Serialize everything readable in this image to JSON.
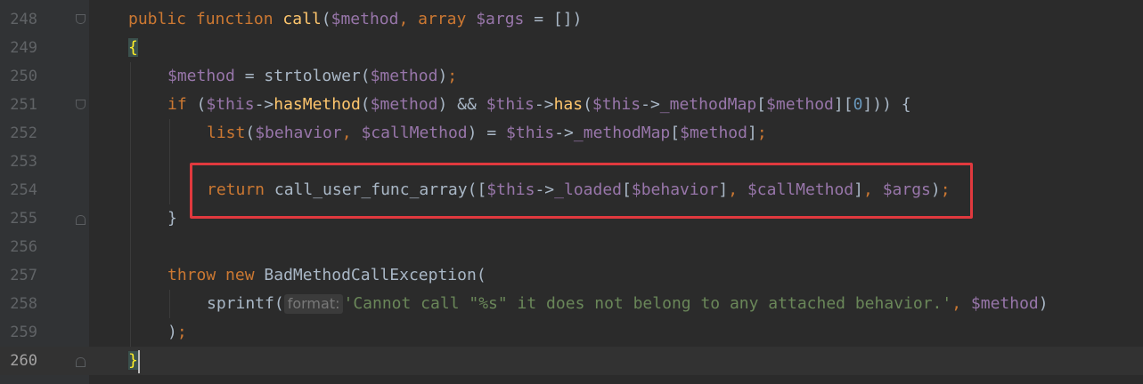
{
  "gutter": {
    "line_numbers": [
      "248",
      "249",
      "250",
      "251",
      "252",
      "253",
      "254",
      "255",
      "256",
      "257",
      "258",
      "259",
      "260"
    ]
  },
  "code": {
    "l248": {
      "kw1": "public",
      "kw2": "function",
      "fn": "call",
      "p1": "(",
      "v1": "$method",
      "c1": ", ",
      "kw3": "array",
      "sp": " ",
      "v2": "$args",
      "p2": " = [])"
    },
    "l249": {
      "brace": "{"
    },
    "l250": {
      "v1": "$method",
      "p1": " = strtolower(",
      "v2": "$method",
      "p2": ")",
      "sc": ";"
    },
    "l251": {
      "kw": "if",
      "p1": " (",
      "v1": "$this",
      "a1": "->",
      "fn1": "hasMethod",
      "p2": "(",
      "v2": "$method",
      "p3": ") && ",
      "v3": "$this",
      "a2": "->",
      "fn2": "has",
      "p4": "(",
      "v4": "$this",
      "a3": "->",
      "v5": "_methodMap",
      "p5": "[",
      "v6": "$method",
      "p6": "][",
      "n": "0",
      "p7": "])) {"
    },
    "l252": {
      "kw": "list",
      "p1": "(",
      "v1": "$behavior",
      "c1": ", ",
      "v2": "$callMethod",
      "p2": ") = ",
      "v3": "$this",
      "a1": "->",
      "v4": "_methodMap",
      "p3": "[",
      "v5": "$method",
      "p4": "]",
      "sc": ";"
    },
    "l254": {
      "kw": "return",
      "p1": " call_user_func_array([",
      "v1": "$this",
      "a1": "->",
      "v2": "_loaded",
      "p2": "[",
      "v3": "$behavior",
      "p3": "]",
      "c1": ", ",
      "v4": "$callMethod",
      "p4": "]",
      "c2": ", ",
      "v5": "$args",
      "p5": ")",
      "sc": ";"
    },
    "l255": {
      "brace": "}"
    },
    "l257": {
      "kw1": "throw",
      "kw2": "new",
      "cls": "BadMethodCallException",
      "p1": "("
    },
    "l258": {
      "fn": "sprintf(",
      "hint": "format:",
      "str": "'Cannot call \"%s\" it does not belong to any attached behavior.'",
      "c1": ", ",
      "v1": "$method",
      "p1": ")"
    },
    "l259": {
      "p1": ")",
      "sc": ";"
    },
    "l260": {
      "brace": "}"
    }
  },
  "annotation": {
    "color": "#e0393e",
    "target_line": "254"
  }
}
